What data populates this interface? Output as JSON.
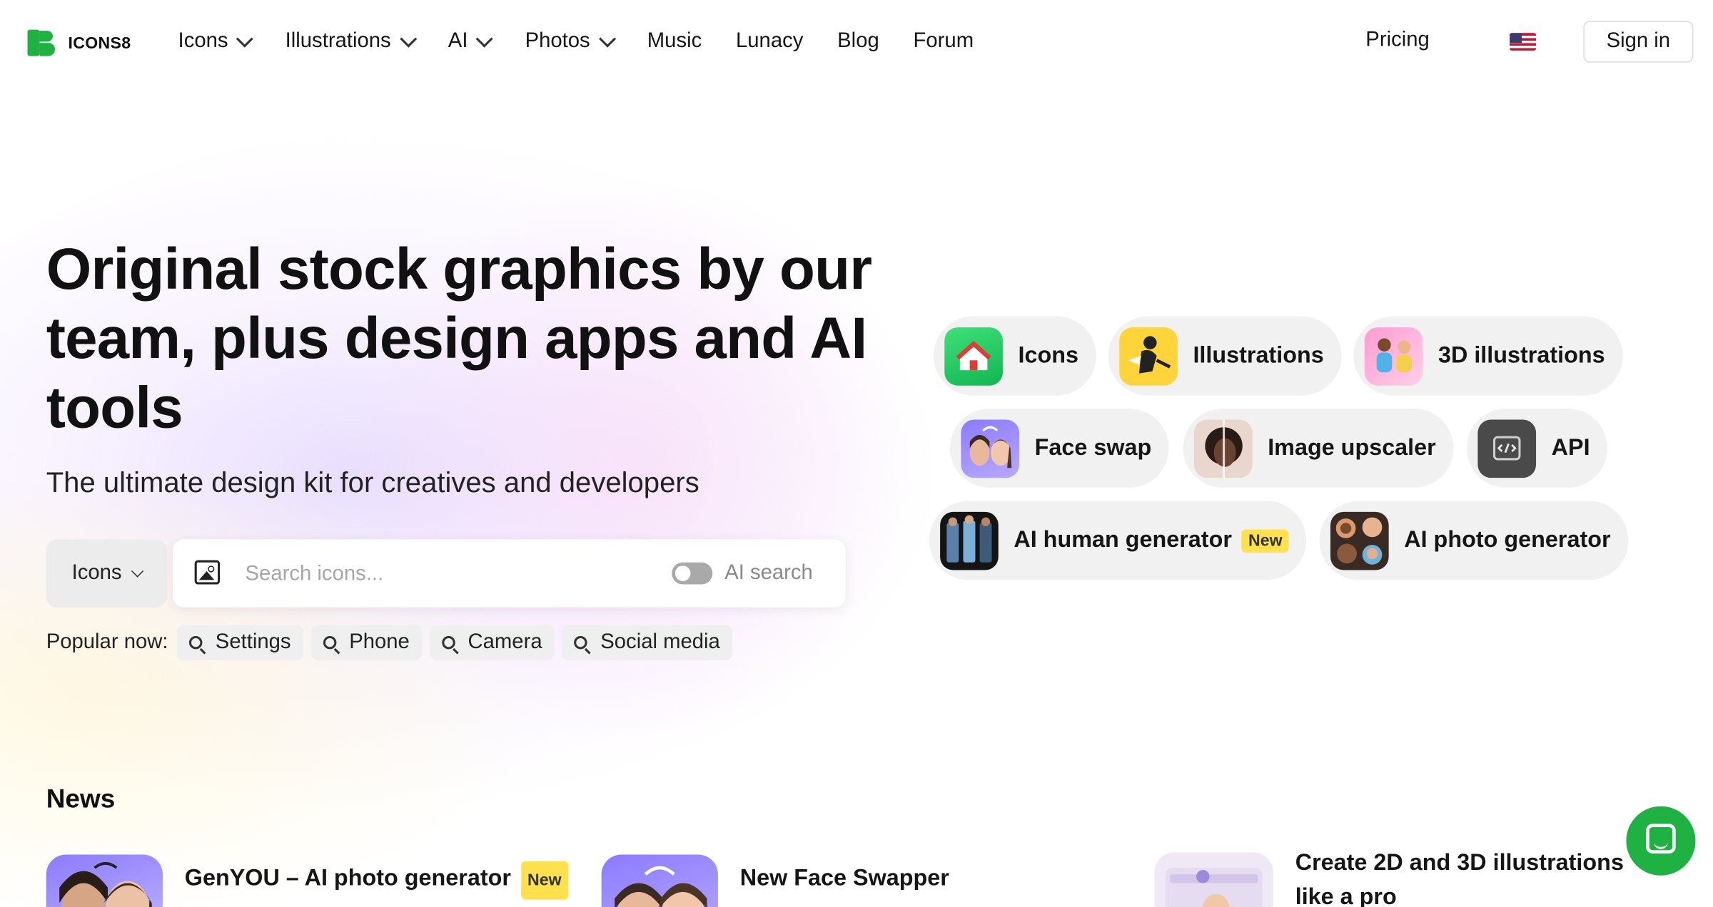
{
  "brand": {
    "name": "ICONS8",
    "accent": "#1FB141"
  },
  "nav": {
    "items": [
      {
        "label": "Icons",
        "has_dropdown": true
      },
      {
        "label": "Illustrations",
        "has_dropdown": true
      },
      {
        "label": "AI",
        "has_dropdown": true
      },
      {
        "label": "Photos",
        "has_dropdown": true
      },
      {
        "label": "Music",
        "has_dropdown": false
      },
      {
        "label": "Lunacy",
        "has_dropdown": false
      },
      {
        "label": "Blog",
        "has_dropdown": false
      },
      {
        "label": "Forum",
        "has_dropdown": false
      }
    ],
    "pricing": "Pricing",
    "language_icon": "us-flag-icon",
    "sign_in": "Sign in"
  },
  "hero": {
    "title": "Original stock graphics by our team, plus design apps and AI tools",
    "subtitle": "The ultimate design kit for creatives and developers"
  },
  "search": {
    "type_selected": "Icons",
    "placeholder": "Search icons...",
    "ai_search_label": "AI search",
    "ai_search_enabled": false
  },
  "popular": {
    "label": "Popular now:",
    "chips": [
      "Settings",
      "Phone",
      "Camera",
      "Social media"
    ]
  },
  "products": [
    {
      "label": "Icons"
    },
    {
      "label": "Illustrations"
    },
    {
      "label": "3D illustrations"
    },
    {
      "label": "Face swap"
    },
    {
      "label": "Image upscaler"
    },
    {
      "label": "API"
    },
    {
      "label": "AI human generator",
      "badge": "New"
    },
    {
      "label": "AI photo generator"
    }
  ],
  "news": {
    "title": "News",
    "items": [
      {
        "title": "GenYOU – AI photo generator",
        "badge": "New"
      },
      {
        "title": "New Face Swapper"
      },
      {
        "title": "Create 2D and 3D illustrations like a pro"
      }
    ]
  }
}
